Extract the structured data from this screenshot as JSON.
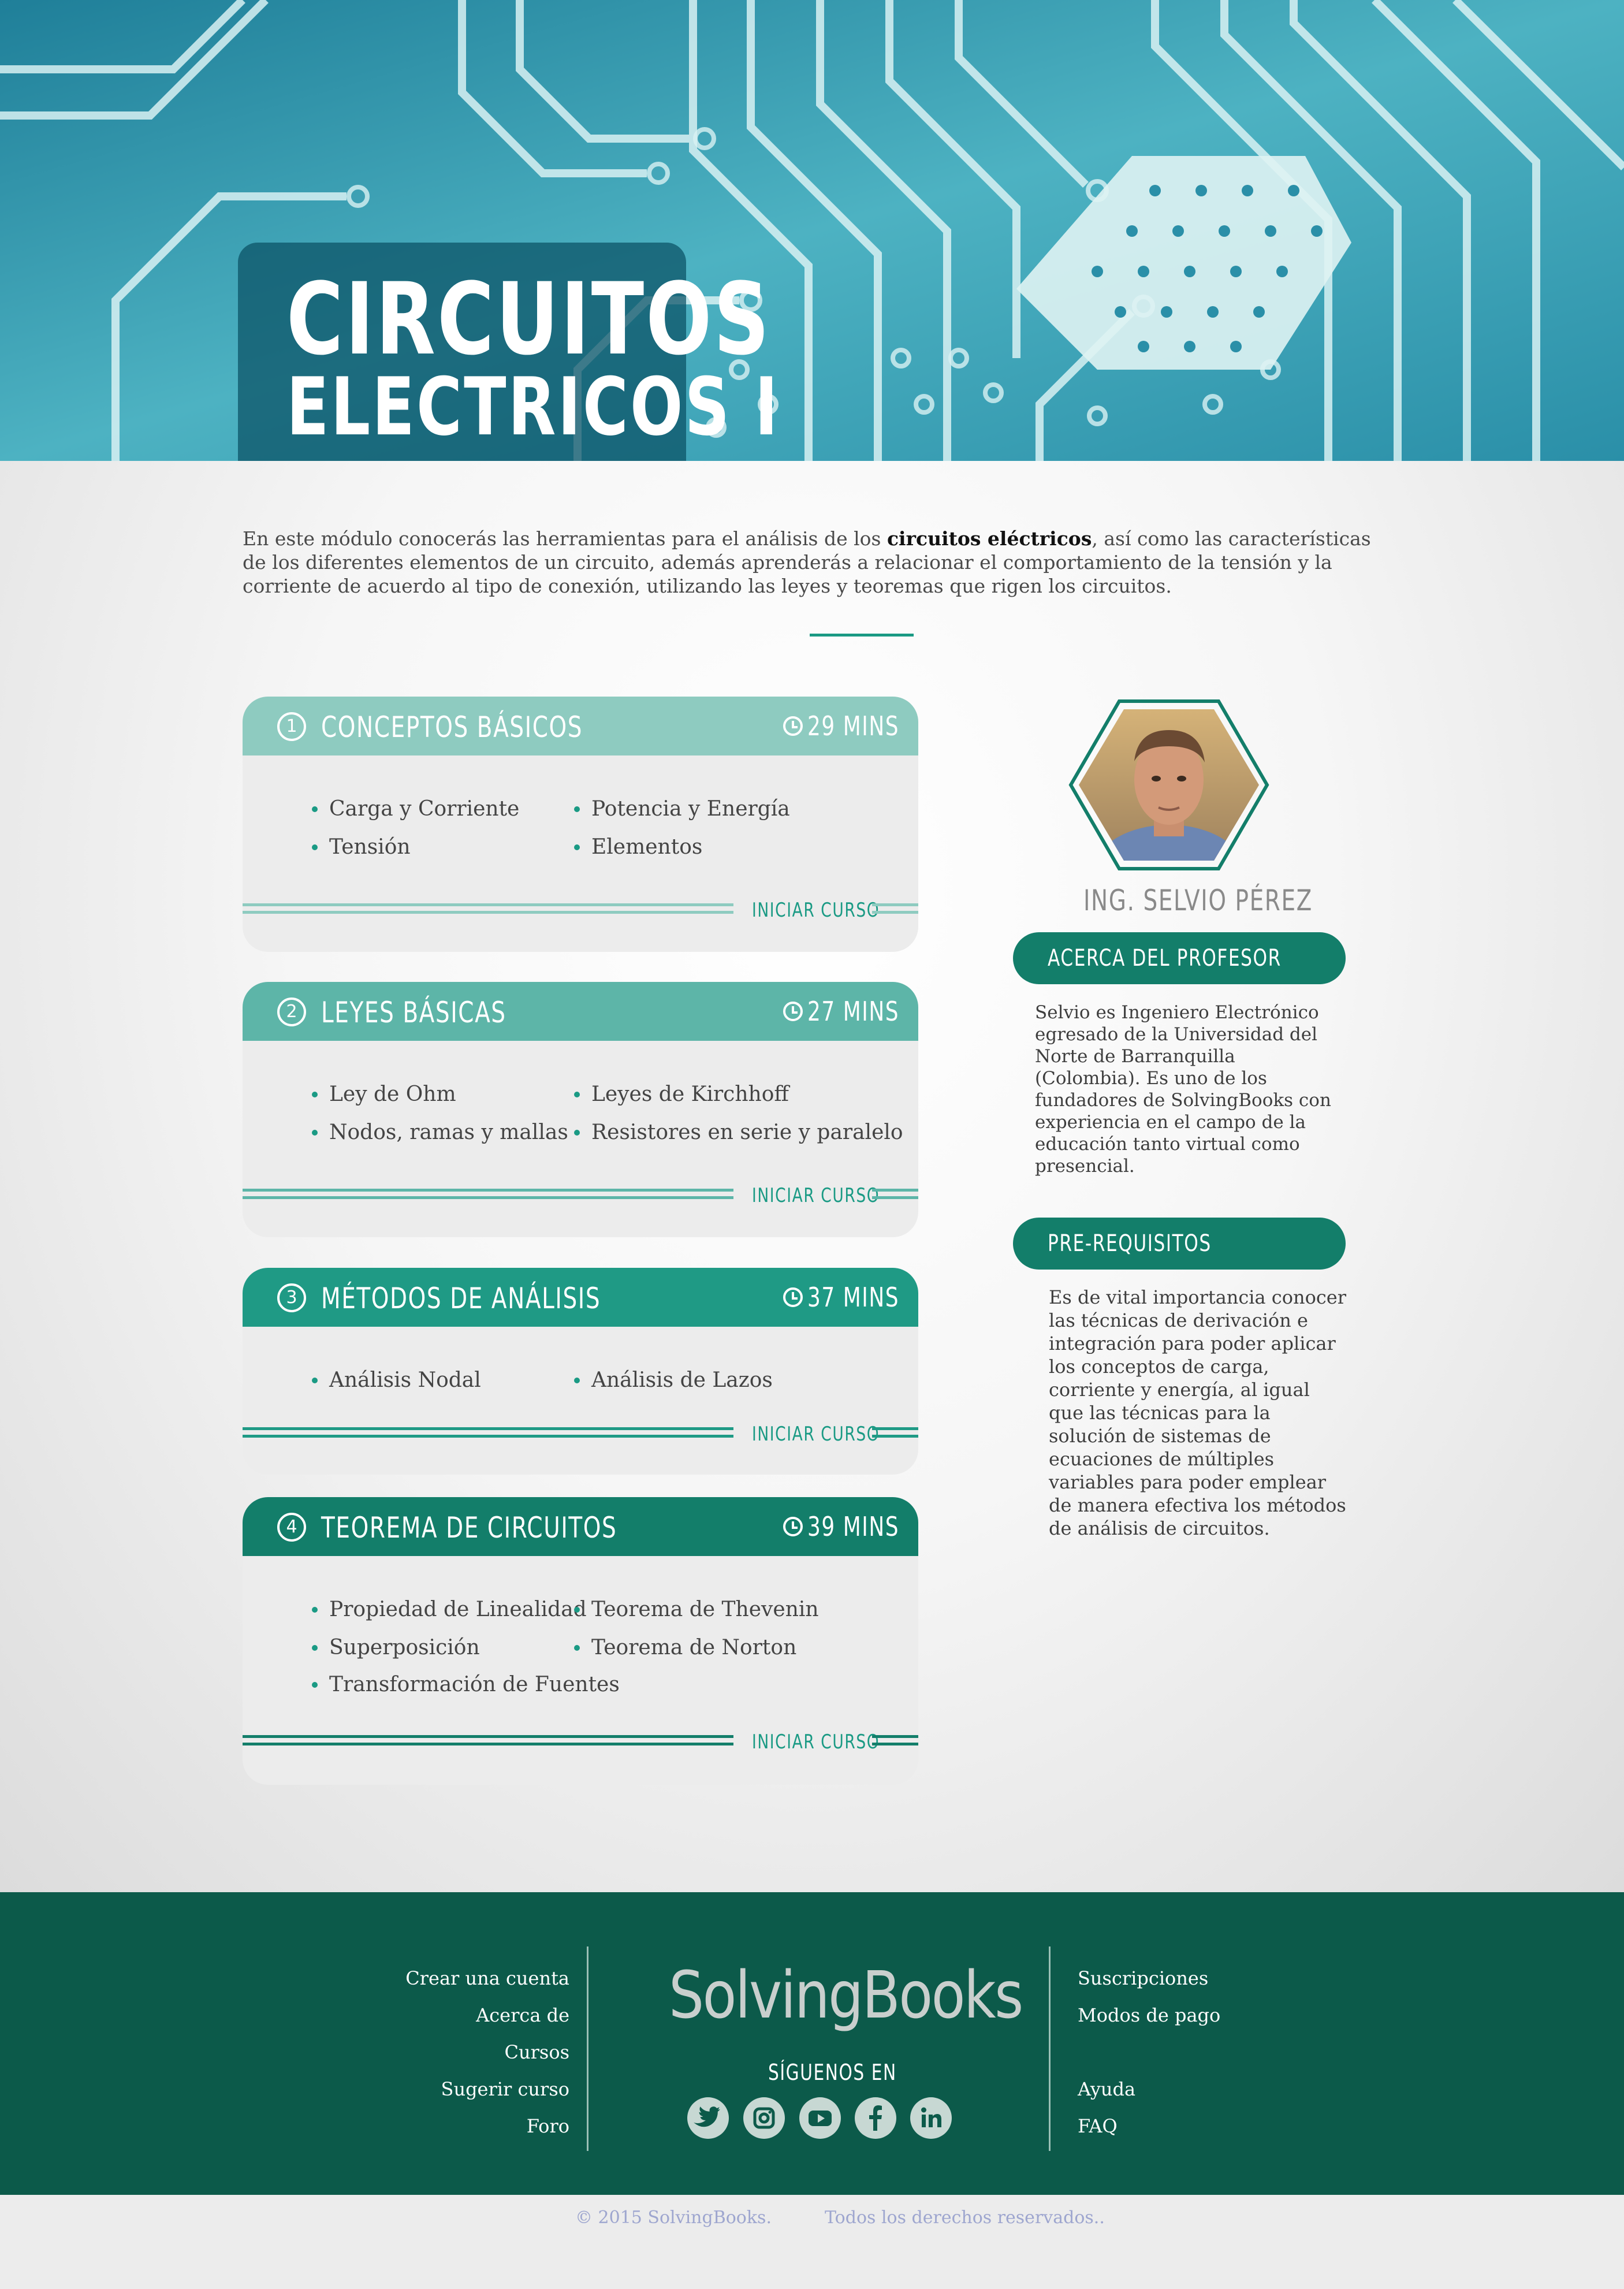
{
  "hero": {
    "title_line1": "CIRCUITOS",
    "title_line2": "ELECTRICOS I"
  },
  "intro": {
    "before": "En este módulo conocerás las herramientas para el análisis de los ",
    "bold": "circuitos eléctricos",
    "after": ", así como las características de los diferentes elementos de un circuito, además aprenderás a relacionar el comportamiento de la tensión y la corriente de acuerdo al tipo de conexión, utilizando las leyes y teoremas que rigen los circuitos."
  },
  "courses": [
    {
      "number": "1",
      "title": "CONCEPTOS BÁSICOS",
      "time": "29 MINS",
      "color": "#8ecbc0",
      "line_color": "#8ecbc0",
      "topics": [
        "Carga y Corriente",
        "Potencia y Energía",
        "Tensión",
        "Elementos"
      ],
      "action": "INICIAR CURSO"
    },
    {
      "number": "2",
      "title": "LEYES BÁSICAS",
      "time": "27 MINS",
      "color": "#5db5a8",
      "line_color": "#5db5a8",
      "topics": [
        "Ley de Ohm",
        "Leyes de Kirchhoff",
        "Nodos, ramas y mallas",
        "Resistores en serie y paralelo"
      ],
      "action": "INICIAR CURSO"
    },
    {
      "number": "3",
      "title": "MÉTODOS DE ANÁLISIS",
      "time": "37 MINS",
      "color": "#1f9a85",
      "line_color": "#1f9a85",
      "topics": [
        "Análisis Nodal",
        "Análisis de Lazos"
      ],
      "action": "INICIAR CURSO"
    },
    {
      "number": "4",
      "title": "TEOREMA DE CIRCUITOS",
      "time": "39 MINS",
      "color": "#137e6a",
      "line_color": "#137e6a",
      "topics": [
        "Propiedad de Linealidad",
        "Teorema de Thevenin",
        "Superposición",
        "Teorema de Norton",
        "Transformación de Fuentes"
      ],
      "action": "INICIAR CURSO"
    }
  ],
  "teacher": {
    "name": "ING. SELVIO PÉREZ",
    "about_label": "ACERCA DEL PROFESOR",
    "about_text": "Selvio es Ingeniero Electrónico egresado de la Universidad del Norte de Barranquilla (Colombia). Es uno de los fundadores de SolvingBooks con experiencia en el campo de la educación tanto virtual como presencial.",
    "prereq_label": "PRE-REQUISITOS",
    "prereq_text": "Es de vital importancia conocer las técnicas de derivación e integración para poder aplicar los conceptos de carga, corriente y energía, al igual que las técnicas para la solución de sistemas de ecuaciones de múltiples variables para poder emplear de manera efectiva los métodos de análisis de circuitos."
  },
  "footer": {
    "left_links": [
      "Crear una cuenta",
      "Acerca de",
      "Cursos",
      "Sugerir curso",
      "Foro"
    ],
    "logo": "SolvingBooks",
    "follow_label": "SÍGUENOS EN",
    "social": [
      "twitter-icon",
      "instagram-icon",
      "youtube-icon",
      "facebook-icon",
      "linkedin-icon"
    ],
    "right_links_top": [
      "Suscripciones",
      "Modos de pago"
    ],
    "right_links_bottom": [
      "Ayuda",
      "FAQ"
    ],
    "copyright": "© 2015 SolvingBooks.",
    "rights": "Todos los derechos reservados.."
  }
}
